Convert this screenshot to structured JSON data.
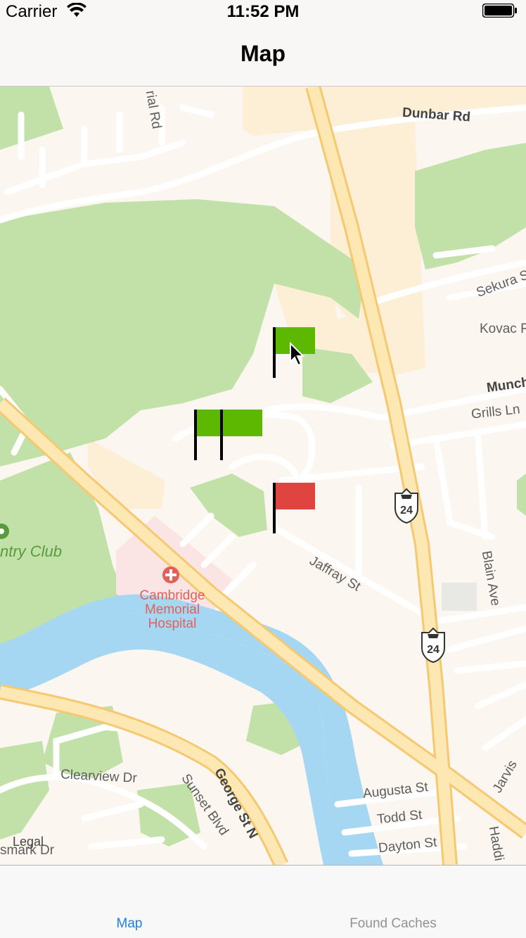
{
  "status_bar": {
    "carrier": "Carrier",
    "time": "11:52 PM"
  },
  "nav_bar": {
    "title": "Map"
  },
  "map": {
    "roads": {
      "dunbar": "Dunbar Rd",
      "imperial": "rial Rd",
      "sekura": "Sekura S",
      "kovac": "Kovac R",
      "munch": "Munch",
      "grills": "Grills Ln",
      "jaffray": "Jaffray St",
      "blain": "Blain Ave",
      "clearview": "Clearview Dr",
      "sunset": "Sunset Blvd",
      "george": "George St N",
      "augusta": "Augusta St",
      "todd": "Todd St",
      "dayton": "Dayton St",
      "jarvis": "Jarvis",
      "haddi": "Haddi",
      "smark": "smark Dr"
    },
    "places": {
      "country_club": "ntry Club",
      "hospital_line1": "Cambridge",
      "hospital_line2": "Memorial",
      "hospital_line3": "Hospital"
    },
    "highway_number": "24",
    "legal": "Legal",
    "flags": [
      {
        "name": "flag-green-1",
        "color": "#5cb800",
        "status": "not found"
      },
      {
        "name": "flag-green-2",
        "color": "#5cb800",
        "status": "not found"
      },
      {
        "name": "flag-green-3",
        "color": "#5cb800",
        "status": "not found"
      },
      {
        "name": "flag-red",
        "color": "#e04440",
        "status": "found"
      }
    ]
  },
  "tab_bar": {
    "tabs": [
      {
        "label": "Map",
        "active": true
      },
      {
        "label": "Found Caches",
        "active": false
      }
    ]
  },
  "colors": {
    "accent": "#1d7fe0",
    "park": "#c2e1a9",
    "water": "#a6d7f2",
    "road_major": "#f8d78a",
    "land": "#fbf8f3"
  }
}
